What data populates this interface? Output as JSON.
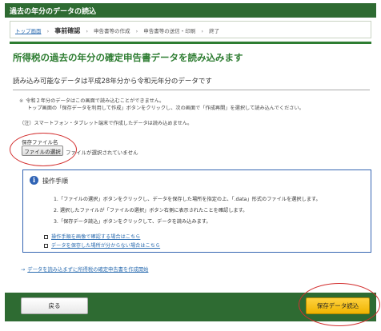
{
  "window": {
    "title": "過去の年分のデータの読込"
  },
  "breadcrumb": [
    {
      "label": "トップ画面",
      "type": "link"
    },
    {
      "label": "事前確認",
      "type": "current"
    },
    {
      "label": "申告書等の作成",
      "type": "step"
    },
    {
      "label": "申告書等の送信・印刷",
      "type": "step"
    },
    {
      "label": "終了",
      "type": "step"
    }
  ],
  "breadcrumb_separator": "›",
  "page": {
    "title": "所得税の過去の年分の確定申告書データを読み込みます",
    "subheading": "読み込み可能なデータは平成28年分から令和元年分のデータです"
  },
  "notes": {
    "mark": "※",
    "line1": "令和２年分のデータはこの画面で読み込むことができません。",
    "line2": "トップ画面の「保存データを利用して作成」ボタンをクリックし、次の画面で「作成再開」を選択して読み込んでください。",
    "caution": "（注）スマートフォン・タブレット端末で作成したデータは読み込めません。"
  },
  "file": {
    "label": "保存ファイル名",
    "button_label": "ファイルの選択",
    "status": "ファイルが選択されていません"
  },
  "procedure": {
    "icon": "info-icon",
    "title": "操作手順",
    "steps": [
      "1.「ファイルの選択」ボタンをクリックし、データを保存した場所を指定の上、「.data」形式のファイルを選択します。",
      "2. 選択したファイルが「ファイルの選択」ボタン右側に表示されたことを確認します。",
      "3.「保存データ読込」ボタンをクリックして、データを読み込みます。"
    ],
    "links": [
      "操作手順を画像で確認する場合はこちら",
      "データを保存した場所が分からない場合はこちら"
    ]
  },
  "bottom_link": {
    "arrow": "→",
    "label": "データを読み込まずに所得税の確定申告書を作成開始"
  },
  "footer": {
    "back_label": "戻る",
    "save_label": "保存データ読込"
  },
  "colors": {
    "header_green": "#2e6b32",
    "title_green": "#2e7d32",
    "link_blue": "#2b6cb0",
    "info_box_border": "#3565b2",
    "primary_button": "#f0b400",
    "annotation_red": "#d32f2f"
  }
}
